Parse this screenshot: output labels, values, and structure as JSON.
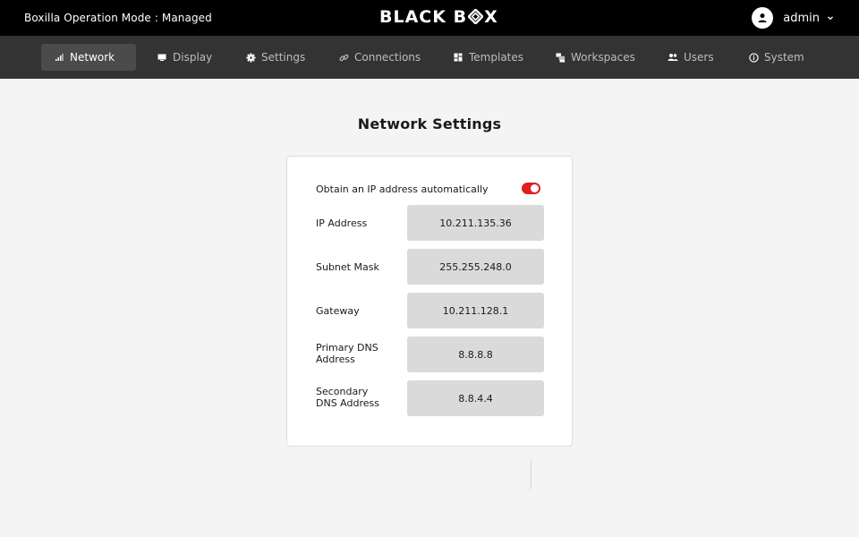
{
  "header": {
    "operation_mode": "Boxilla Operation Mode : Managed",
    "brand": {
      "part1": "BLACK B",
      "part2": "X"
    },
    "user": {
      "name": "admin"
    }
  },
  "nav": {
    "items": [
      {
        "label": "Network",
        "icon": "signal-icon",
        "active": true
      },
      {
        "label": "Display",
        "icon": "monitor-icon",
        "active": false
      },
      {
        "label": "Settings",
        "icon": "gear-icon",
        "active": false
      },
      {
        "label": "Connections",
        "icon": "link-icon",
        "active": false
      },
      {
        "label": "Templates",
        "icon": "grid-icon",
        "active": false
      },
      {
        "label": "Workspaces",
        "icon": "workspaces-icon",
        "active": false
      },
      {
        "label": "Users",
        "icon": "users-icon",
        "active": false
      },
      {
        "label": "System",
        "icon": "info-icon",
        "active": false
      }
    ]
  },
  "page": {
    "title": "Network Settings"
  },
  "network": {
    "dhcp": {
      "label": "Obtain an IP address automatically",
      "enabled": true
    },
    "fields": [
      {
        "label": "IP Address",
        "value": "10.211.135.36"
      },
      {
        "label": "Subnet Mask",
        "value": "255.255.248.0"
      },
      {
        "label": "Gateway",
        "value": "10.211.128.1"
      },
      {
        "label_line1": "Primary DNS",
        "label_line2": "Address",
        "value": "8.8.8.8"
      },
      {
        "label_line1": "Secondary",
        "label_line2": "DNS Address",
        "value": "8.8.4.4"
      }
    ]
  },
  "colors": {
    "accent": "#e02020",
    "topbar": "#000000",
    "navbar": "#333333",
    "field_bg": "#dadada"
  }
}
